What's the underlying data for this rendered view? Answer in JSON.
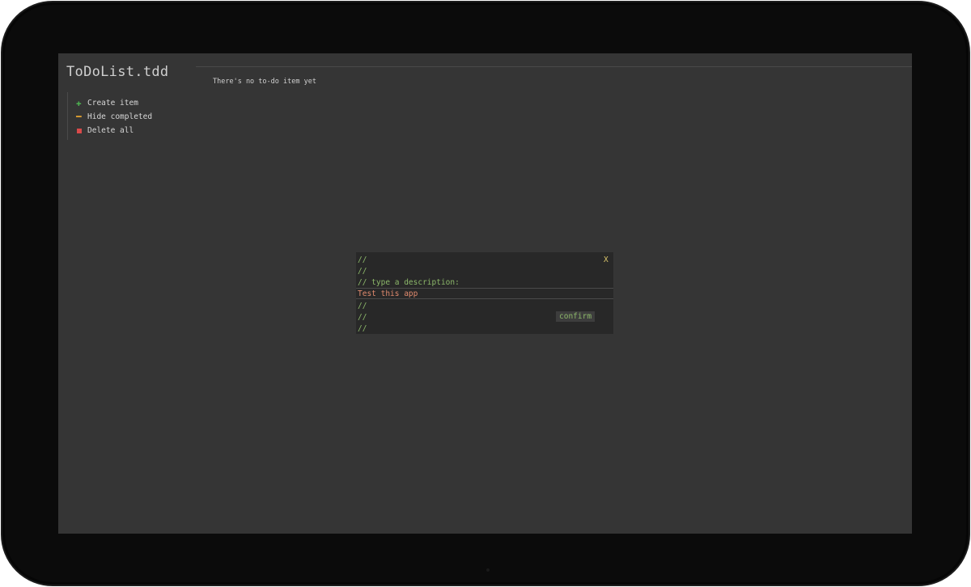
{
  "app": {
    "title": "ToDoList.tdd"
  },
  "sidebar": {
    "items": [
      {
        "label": "Create item",
        "icon": "plus-icon",
        "color": "#4caf50"
      },
      {
        "label": "Hide completed",
        "icon": "minus-icon",
        "color": "#e0a030"
      },
      {
        "label": "Delete all",
        "icon": "square-icon",
        "color": "#d94a4a"
      }
    ]
  },
  "main": {
    "empty_message": "There's no to-do item yet"
  },
  "dialog": {
    "lines": [
      "//",
      "//",
      "// type a description:",
      "//",
      "//",
      "//"
    ],
    "close_label": "X",
    "input_value": "Test this app",
    "confirm_label": "confirm"
  },
  "colors": {
    "screen_bg": "#353535",
    "dialog_bg": "#282828",
    "comment_green": "#8db96a",
    "input_text": "#e08a6e",
    "close_yellow": "#d9c46a"
  }
}
